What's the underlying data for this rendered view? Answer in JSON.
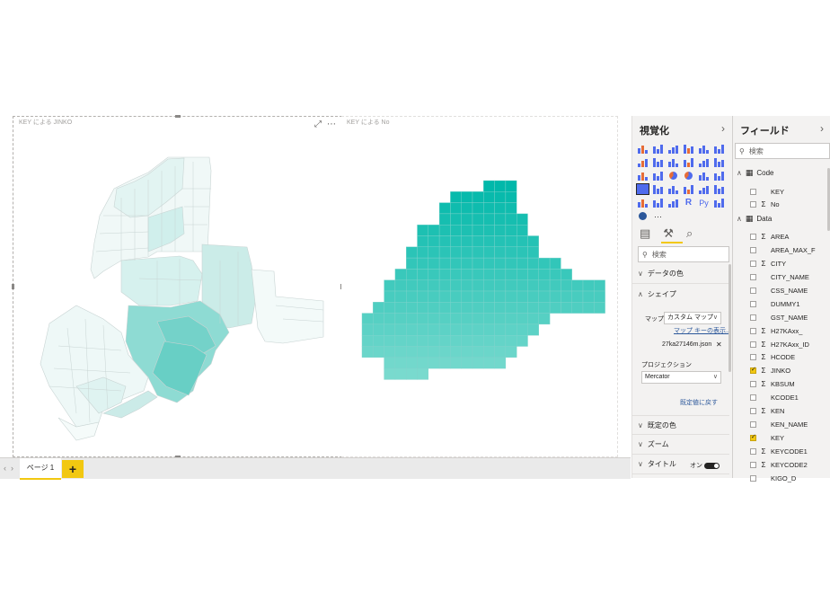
{
  "canvas": {
    "visual_left": {
      "title": "KEY による JINKO"
    },
    "visual_right": {
      "title": "KEY による No"
    },
    "visual_icons": {
      "focus": "focus-mode-icon",
      "more": "⋯"
    }
  },
  "page_tabs": {
    "tabs": [
      "ページ 1"
    ],
    "add_label": "+"
  },
  "visualizations": {
    "title": "視覚化",
    "collapse_glyph": "›",
    "more_label": "···",
    "search_placeholder": "検索",
    "sections": {
      "data_colors": "データの色",
      "shape": "シェイプ",
      "default_colors": "既定の色",
      "zoom": "ズーム",
      "title": "タイトル"
    },
    "shape": {
      "map_label": "マップ",
      "map_value": "カスタム マップ",
      "map_key_link": "マップ キーの表示...",
      "file_name": "27ka27146m.json",
      "projection_label": "プロジェクション",
      "projection_value": "Mercator",
      "reset_link": "既定値に戻す"
    },
    "title_toggle": {
      "label": "オン",
      "on": true
    }
  },
  "fields": {
    "title": "フィールド",
    "collapse_glyph": "›",
    "search_placeholder": "検索",
    "tables": [
      {
        "name": "Code",
        "fields": [
          {
            "name": "KEY",
            "sigma": false,
            "checked": false
          },
          {
            "name": "No",
            "sigma": true,
            "checked": false
          }
        ]
      },
      {
        "name": "Data",
        "fields": [
          {
            "name": "AREA",
            "sigma": true,
            "checked": false
          },
          {
            "name": "AREA_MAX_F",
            "sigma": false,
            "checked": false
          },
          {
            "name": "CITY",
            "sigma": true,
            "checked": false
          },
          {
            "name": "CITY_NAME",
            "sigma": false,
            "checked": false
          },
          {
            "name": "CSS_NAME",
            "sigma": false,
            "checked": false
          },
          {
            "name": "DUMMY1",
            "sigma": false,
            "checked": false
          },
          {
            "name": "GST_NAME",
            "sigma": false,
            "checked": false
          },
          {
            "name": "H27KAxx_",
            "sigma": true,
            "checked": false
          },
          {
            "name": "H27KAxx_ID",
            "sigma": true,
            "checked": false
          },
          {
            "name": "HCODE",
            "sigma": true,
            "checked": false
          },
          {
            "name": "JINKO",
            "sigma": true,
            "checked": true
          },
          {
            "name": "KBSUM",
            "sigma": true,
            "checked": false
          },
          {
            "name": "KCODE1",
            "sigma": false,
            "checked": false
          },
          {
            "name": "KEN",
            "sigma": true,
            "checked": false
          },
          {
            "name": "KEN_NAME",
            "sigma": false,
            "checked": false
          },
          {
            "name": "KEY",
            "sigma": false,
            "checked": true
          },
          {
            "name": "KEYCODE1",
            "sigma": true,
            "checked": false
          },
          {
            "name": "KEYCODE2",
            "sigma": true,
            "checked": false
          },
          {
            "name": "KIGO_D",
            "sigma": false,
            "checked": false
          }
        ]
      }
    ]
  },
  "colors": {
    "accent": "#f2c811",
    "teal": "#01b8aa",
    "pane": "#f3f2f1"
  }
}
